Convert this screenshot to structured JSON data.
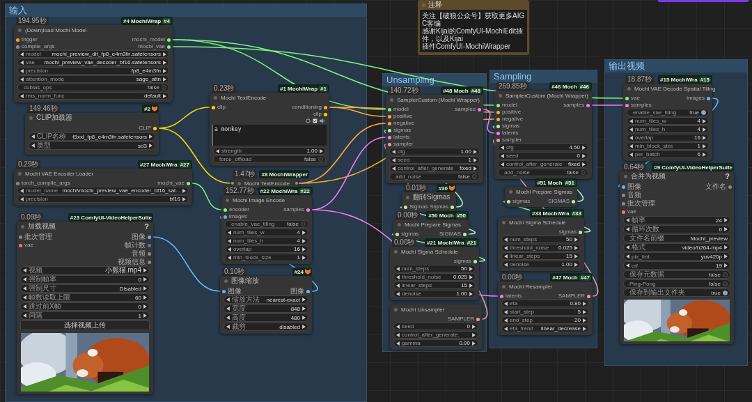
{
  "groups": [
    {
      "title": "输入"
    },
    {
      "title": "Unsampling"
    },
    {
      "title": "Sampling"
    },
    {
      "title": "输出视频"
    }
  ],
  "note": {
    "title": "注释",
    "lines": [
      "关注【破狼公众号】获取更多AIGC客编",
      "感谢Kijai的ComfyUI-MochiEdit插件，以及Kijai",
      "插件ComfyUI-MochiWrapper"
    ]
  },
  "nodes": [
    {
      "time": "194.95秒",
      "badge": {
        "text": "#4 MochiWrap",
        "tag": "#4",
        "icon": false
      },
      "title": "(Down)load Mochi Model",
      "collapsed": false,
      "inputs": [
        {
          "name": "trigger",
          "color": "#f5a623"
        },
        {
          "name": "compile_args",
          "color": "#8a8a8a"
        }
      ],
      "outputs": [
        {
          "name": "mochi_model",
          "color": "#7cf57c"
        },
        {
          "name": "mochi_vae",
          "color": "#7cf57c"
        }
      ],
      "widgets": [
        {
          "kind": "combo",
          "label": "model",
          "value": "mochi_preview_dit_fp8_e4m3fn.safetensors"
        },
        {
          "kind": "combo",
          "label": "vae",
          "value": "mochi_preview_vae_decoder_bf16.safetensors"
        },
        {
          "kind": "combo",
          "label": "precision",
          "value": "fp8_e4m3fn"
        },
        {
          "kind": "combo",
          "label": "attention_mode",
          "value": "sage_attn"
        },
        {
          "kind": "toggle",
          "label": "cublas_ops",
          "value": "false",
          "on": false
        },
        {
          "kind": "combo",
          "label": "rms_norm_func",
          "value": "default"
        }
      ]
    },
    {
      "time": "149.46秒",
      "badge": {
        "text": "#2",
        "icon": true
      },
      "title": "CLIP加载器",
      "collapsed": false,
      "outputs": [
        {
          "name": "CLIP",
          "color": "#ffd500"
        }
      ],
      "widgets": [
        {
          "kind": "combo",
          "label": "CLIP名称",
          "value": "t5xxl_fp8_e4m3fn.safetensors"
        },
        {
          "kind": "combo",
          "label": "类型",
          "value": "sd3"
        }
      ]
    },
    {
      "time": "0.29秒",
      "badge": {
        "text": "#27 MochiWra",
        "tag": "#27",
        "icon": false
      },
      "title": "Mochi VAE Encoder Loader",
      "collapsed": false,
      "inputs": [
        {
          "name": "torch_compile_args",
          "color": "#8a8a8a"
        }
      ],
      "outputs": [
        {
          "name": "mochi_vae",
          "color": "#7cf57c"
        }
      ],
      "widgets": [
        {
          "kind": "combo",
          "label": "model_name",
          "value": "mochi\\mochi_preview_vae_encoder_bf16_sat..."
        },
        {
          "kind": "combo",
          "label": "precision",
          "value": "bf16"
        }
      ]
    },
    {
      "time": "0.09秒",
      "badge": {
        "text": "#23 ComfyUI-VideoHelperSuite",
        "icon": false
      },
      "title": "加载视频",
      "help": "?",
      "collapsed": false,
      "inputs": [
        {
          "name": "批次管理",
          "color": "#8a8a8a"
        },
        {
          "name": "vae",
          "color": "#ff6e6e"
        }
      ],
      "outputs": [
        {
          "name": "图像",
          "color": "#64b5f6"
        },
        {
          "name": "帧计数",
          "color": "#3f7fc0"
        },
        {
          "name": "音频",
          "color": "#8a8a8a"
        },
        {
          "name": "视频信息",
          "color": "#8a8a8a"
        }
      ],
      "widgets": [
        {
          "kind": "combo",
          "label": "视频",
          "value": "小熊猫.mp4"
        },
        {
          "kind": "combo",
          "label": "强制帧率",
          "value": "0"
        },
        {
          "kind": "combo",
          "label": "强制尺寸",
          "value": "Disabled"
        },
        {
          "kind": "combo",
          "label": "帧数读取上限",
          "value": "60"
        },
        {
          "kind": "combo",
          "label": "跳过前X帧",
          "value": "0"
        },
        {
          "kind": "combo",
          "label": "间隔",
          "value": "1"
        },
        {
          "kind": "button",
          "label": "选择视频上传"
        }
      ],
      "preview": {
        "kind": "picture"
      }
    },
    {
      "time": "0.23秒",
      "badge": {
        "text": "#1 MochiWrap",
        "tag": "#1",
        "icon": false
      },
      "title": "Mochi TextEncode",
      "collapsed": false,
      "inputs": [
        {
          "name": "clip",
          "color": "#ffd500"
        }
      ],
      "outputs": [
        {
          "name": "conditioning",
          "color": "#ffa931"
        },
        {
          "name": "clip",
          "color": "#ffd500"
        }
      ],
      "prompt": "a monkey",
      "widgets": [
        {
          "kind": "combo",
          "label": "strength",
          "value": "1.00"
        },
        {
          "kind": "toggle",
          "label": "force_offload",
          "value": "false",
          "on": false
        }
      ]
    },
    {
      "time": "1.47秒",
      "badge": {
        "text": "#8 MochiWrapper",
        "icon": false
      },
      "title": "Mochi TextEncode",
      "collapsed": true
    },
    {
      "time": "152.77秒",
      "badge": {
        "text": "#22 MochiWra",
        "tag": "#22",
        "icon": false
      },
      "title": "Mochi Image Encode",
      "collapsed": false,
      "inputs": [
        {
          "name": "encoder",
          "color": "#7cf57c"
        },
        {
          "name": "images",
          "color": "#64b5f6"
        }
      ],
      "outputs": [
        {
          "name": "samples",
          "color": "#f07ef0"
        }
      ],
      "widgets": [
        {
          "kind": "toggle",
          "label": "enable_vae_tiling",
          "value": "false",
          "on": false
        },
        {
          "kind": "combo",
          "label": "num_tiles_w",
          "value": "4"
        },
        {
          "kind": "combo",
          "label": "num_tiles_h",
          "value": "4"
        },
        {
          "kind": "combo",
          "label": "overlap",
          "value": "16"
        },
        {
          "kind": "combo",
          "label": "min_block_size",
          "value": "1"
        }
      ]
    },
    {
      "time": "0.10秒",
      "badge": {
        "text": "#24",
        "icon": true
      },
      "title": "图像缩放",
      "collapsed": false,
      "inputs": [
        {
          "name": "图像",
          "color": "#64b5f6"
        }
      ],
      "outputs": [
        {
          "name": "图像",
          "color": "#64b5f6"
        }
      ],
      "widgets": [
        {
          "kind": "combo",
          "label": "缩放方法",
          "value": "nearest-exact"
        },
        {
          "kind": "combo",
          "label": "宽度",
          "value": "848"
        },
        {
          "kind": "combo",
          "label": "高度",
          "value": "480"
        },
        {
          "kind": "combo",
          "label": "裁剪",
          "value": "disabled"
        }
      ]
    },
    {
      "time": "140.72秒",
      "badge": {
        "text": "#48 Moch",
        "tag": "#48",
        "icon": false
      },
      "title": "SamplerCustom (Mochi Wrapper)",
      "collapsed": false,
      "inputs": [
        {
          "name": "model",
          "color": "#7cf57c"
        },
        {
          "name": "positive",
          "color": "#ffa931"
        },
        {
          "name": "negative",
          "color": "#ffa931"
        },
        {
          "name": "sigmas",
          "color": "#b4f0b0"
        },
        {
          "name": "latents",
          "color": "#f07ef0"
        },
        {
          "name": "sampler",
          "color": "#ec9c9c"
        }
      ],
      "outputs": [
        {
          "name": "samples",
          "color": "#f07ef0"
        }
      ],
      "widgets": [
        {
          "kind": "combo",
          "label": "cfg",
          "value": "1.00"
        },
        {
          "kind": "combo",
          "label": "seed",
          "value": "1"
        },
        {
          "kind": "combo",
          "label": "control_after_generate",
          "value": "fixed"
        },
        {
          "kind": "toggle",
          "label": "add_noise",
          "value": "false",
          "on": false
        }
      ]
    },
    {
      "time": "0.01秒",
      "badge": {
        "text": "#30",
        "icon": true
      },
      "title": "翻转Sigmas",
      "collapsed": false,
      "inputs": [
        {
          "name": "Sigmas",
          "color": "#b4f0b0"
        }
      ],
      "outputs": [
        {
          "name": "Sigmas",
          "color": "#b4f0b0"
        }
      ]
    },
    {
      "time": "0.00秒",
      "badge": {
        "text": "#50 Moch",
        "tag": "#50",
        "icon": false
      },
      "title": "Mochi Prepare Sigmas",
      "collapsed": false,
      "inputs": [
        {
          "name": "sigmas",
          "color": "#b4f0b0"
        }
      ],
      "outputs": [
        {
          "name": "SIGMAS",
          "color": "#b4f0b0"
        }
      ]
    },
    {
      "time": "0.00秒",
      "badge": {
        "text": "#21 MochiWra",
        "tag": "#21",
        "icon": false
      },
      "title": "Mochi Sigma Schedule",
      "collapsed": false,
      "outputs": [
        {
          "name": "sigmas",
          "color": "#b4f0b0"
        }
      ],
      "widgets": [
        {
          "kind": "combo",
          "label": "num_steps",
          "value": "50"
        },
        {
          "kind": "combo",
          "label": "threshold_noise",
          "value": "0.025"
        },
        {
          "kind": "combo",
          "label": "linear_steps",
          "value": "15"
        },
        {
          "kind": "combo",
          "label": "denoise",
          "value": "1.00"
        }
      ]
    },
    {
      "title": "Mochi Unsampler",
      "collapsed": false,
      "outputs": [
        {
          "name": "SAMPLER",
          "color": "#ec9c9c"
        }
      ],
      "widgets": [
        {
          "kind": "combo",
          "label": "seed",
          "value": "0"
        },
        {
          "kind": "combo",
          "label": "control_after_generate."
        },
        {
          "kind": "combo",
          "label": "gamma",
          "value": "0.00"
        }
      ]
    },
    {
      "time": "269.85秒",
      "badge": {
        "text": "#46 Moch",
        "tag": "#46",
        "icon": false
      },
      "title": "SamplerCustom (Mochi Wrapper)",
      "collapsed": false,
      "inputs": [
        {
          "name": "model",
          "color": "#7cf57c"
        },
        {
          "name": "positive",
          "color": "#ffa931"
        },
        {
          "name": "negative",
          "color": "#ffa931"
        },
        {
          "name": "sigmas",
          "color": "#b4f0b0"
        },
        {
          "name": "latents",
          "color": "#f07ef0"
        },
        {
          "name": "sampler",
          "color": "#ec9c9c"
        }
      ],
      "outputs": [
        {
          "name": "samples",
          "color": "#f07ef0"
        }
      ],
      "widgets": [
        {
          "kind": "combo",
          "label": "cfg",
          "value": "4.50"
        },
        {
          "kind": "combo",
          "label": "seed",
          "value": "0"
        },
        {
          "kind": "combo",
          "label": "control_after_generate",
          "value": "fixed"
        },
        {
          "kind": "toggle",
          "label": "add_noise",
          "value": "false",
          "on": false
        }
      ]
    },
    {
      "badge": {
        "text": "#51 Moch",
        "tag": "#51",
        "icon": false
      },
      "title": "Mochi Prepare Sigmas",
      "collapsed": false,
      "inputs": [
        {
          "name": "sigmas",
          "color": "#b4f0b0"
        }
      ],
      "outputs": [
        {
          "name": "SIGMAS",
          "color": "#b4f0b0"
        }
      ]
    },
    {
      "badge": {
        "text": "#33 MochiWra",
        "tag": "#33",
        "icon": false
      },
      "title": "Mochi Sigma Schedule",
      "collapsed": false,
      "outputs": [
        {
          "name": "sigmas",
          "color": "#b4f0b0"
        }
      ],
      "widgets": [
        {
          "kind": "combo",
          "label": "num_steps",
          "value": "50"
        },
        {
          "kind": "combo",
          "label": "threshold_noise",
          "value": "0.025"
        },
        {
          "kind": "combo",
          "label": "linear_steps",
          "value": "15"
        },
        {
          "kind": "combo",
          "label": "denoise",
          "value": "1.00"
        }
      ]
    },
    {
      "time": "0.00秒",
      "badge": {
        "text": "#47 Moch",
        "tag": "#47",
        "icon": false
      },
      "title": "Mochi Resampler",
      "collapsed": false,
      "inputs": [
        {
          "name": "latents",
          "color": "#f07ef0"
        }
      ],
      "outputs": [
        {
          "name": "SAMPLER",
          "color": "#ec9c9c"
        }
      ],
      "widgets": [
        {
          "kind": "combo",
          "label": "eta",
          "value": "0.80"
        },
        {
          "kind": "combo",
          "label": "start_step",
          "value": "5"
        },
        {
          "kind": "combo",
          "label": "end_step",
          "value": "20"
        },
        {
          "kind": "combo",
          "label": "eta_trend",
          "value": "linear_decrease"
        }
      ]
    },
    {
      "time": "18.87秒",
      "badge": {
        "text": "#15 MochiWra",
        "tag": "#15",
        "icon": false
      },
      "title": "Mochi VAE Decode Spatial Tiling",
      "collapsed": false,
      "inputs": [
        {
          "name": "vae",
          "color": "#7cf57c"
        },
        {
          "name": "samples",
          "color": "#f07ef0"
        }
      ],
      "outputs": [
        {
          "name": "images",
          "color": "#64b5f6"
        }
      ],
      "widgets": [
        {
          "kind": "toggle",
          "label": "enable_vae_tiling",
          "value": "true",
          "on": true
        },
        {
          "kind": "combo",
          "label": "num_tiles_w",
          "value": "4"
        },
        {
          "kind": "combo",
          "label": "num_tiles_h",
          "value": "4"
        },
        {
          "kind": "combo",
          "label": "overlap",
          "value": "16"
        },
        {
          "kind": "combo",
          "label": "min_block_size",
          "value": "1"
        },
        {
          "kind": "combo",
          "label": "per_batch",
          "value": "6"
        }
      ]
    },
    {
      "time": "0.64秒",
      "badge": {
        "text": "#9 ComfyUI-VideoHelperSuite",
        "icon": false
      },
      "title": "合并为视频",
      "help": "?",
      "collapsed": false,
      "inputs": [
        {
          "name": "图像",
          "color": "#64b5f6"
        },
        {
          "name": "音频",
          "color": "#8a8a8a"
        },
        {
          "name": "批次管理",
          "color": "#8a8a8a"
        },
        {
          "name": "vae",
          "color": "#ff6e6e"
        }
      ],
      "outputs": [
        {
          "name": "文件名",
          "color": "#8a8a8a"
        }
      ],
      "widgets": [
        {
          "kind": "combo",
          "label": "帧率",
          "value": "24"
        },
        {
          "kind": "combo",
          "label": "循环次数",
          "value": "0"
        },
        {
          "kind": "text",
          "label": "文件名前缀",
          "value": "Mochi_preview"
        },
        {
          "kind": "combo",
          "label": "格式",
          "value": "video/h264-mp4"
        },
        {
          "kind": "combo",
          "label": "pix_fmt",
          "value": "yuv420p"
        },
        {
          "kind": "combo",
          "label": "crf",
          "value": "19"
        },
        {
          "kind": "toggle",
          "label": "保存元数据",
          "value": "false",
          "on": false
        },
        {
          "kind": "toggle",
          "label": "Ping-Pong",
          "value": "false",
          "on": false
        },
        {
          "kind": "toggle",
          "label": "保存到输出文件夹",
          "value": "true",
          "on": true
        }
      ],
      "preview": {
        "kind": "picture"
      }
    }
  ]
}
